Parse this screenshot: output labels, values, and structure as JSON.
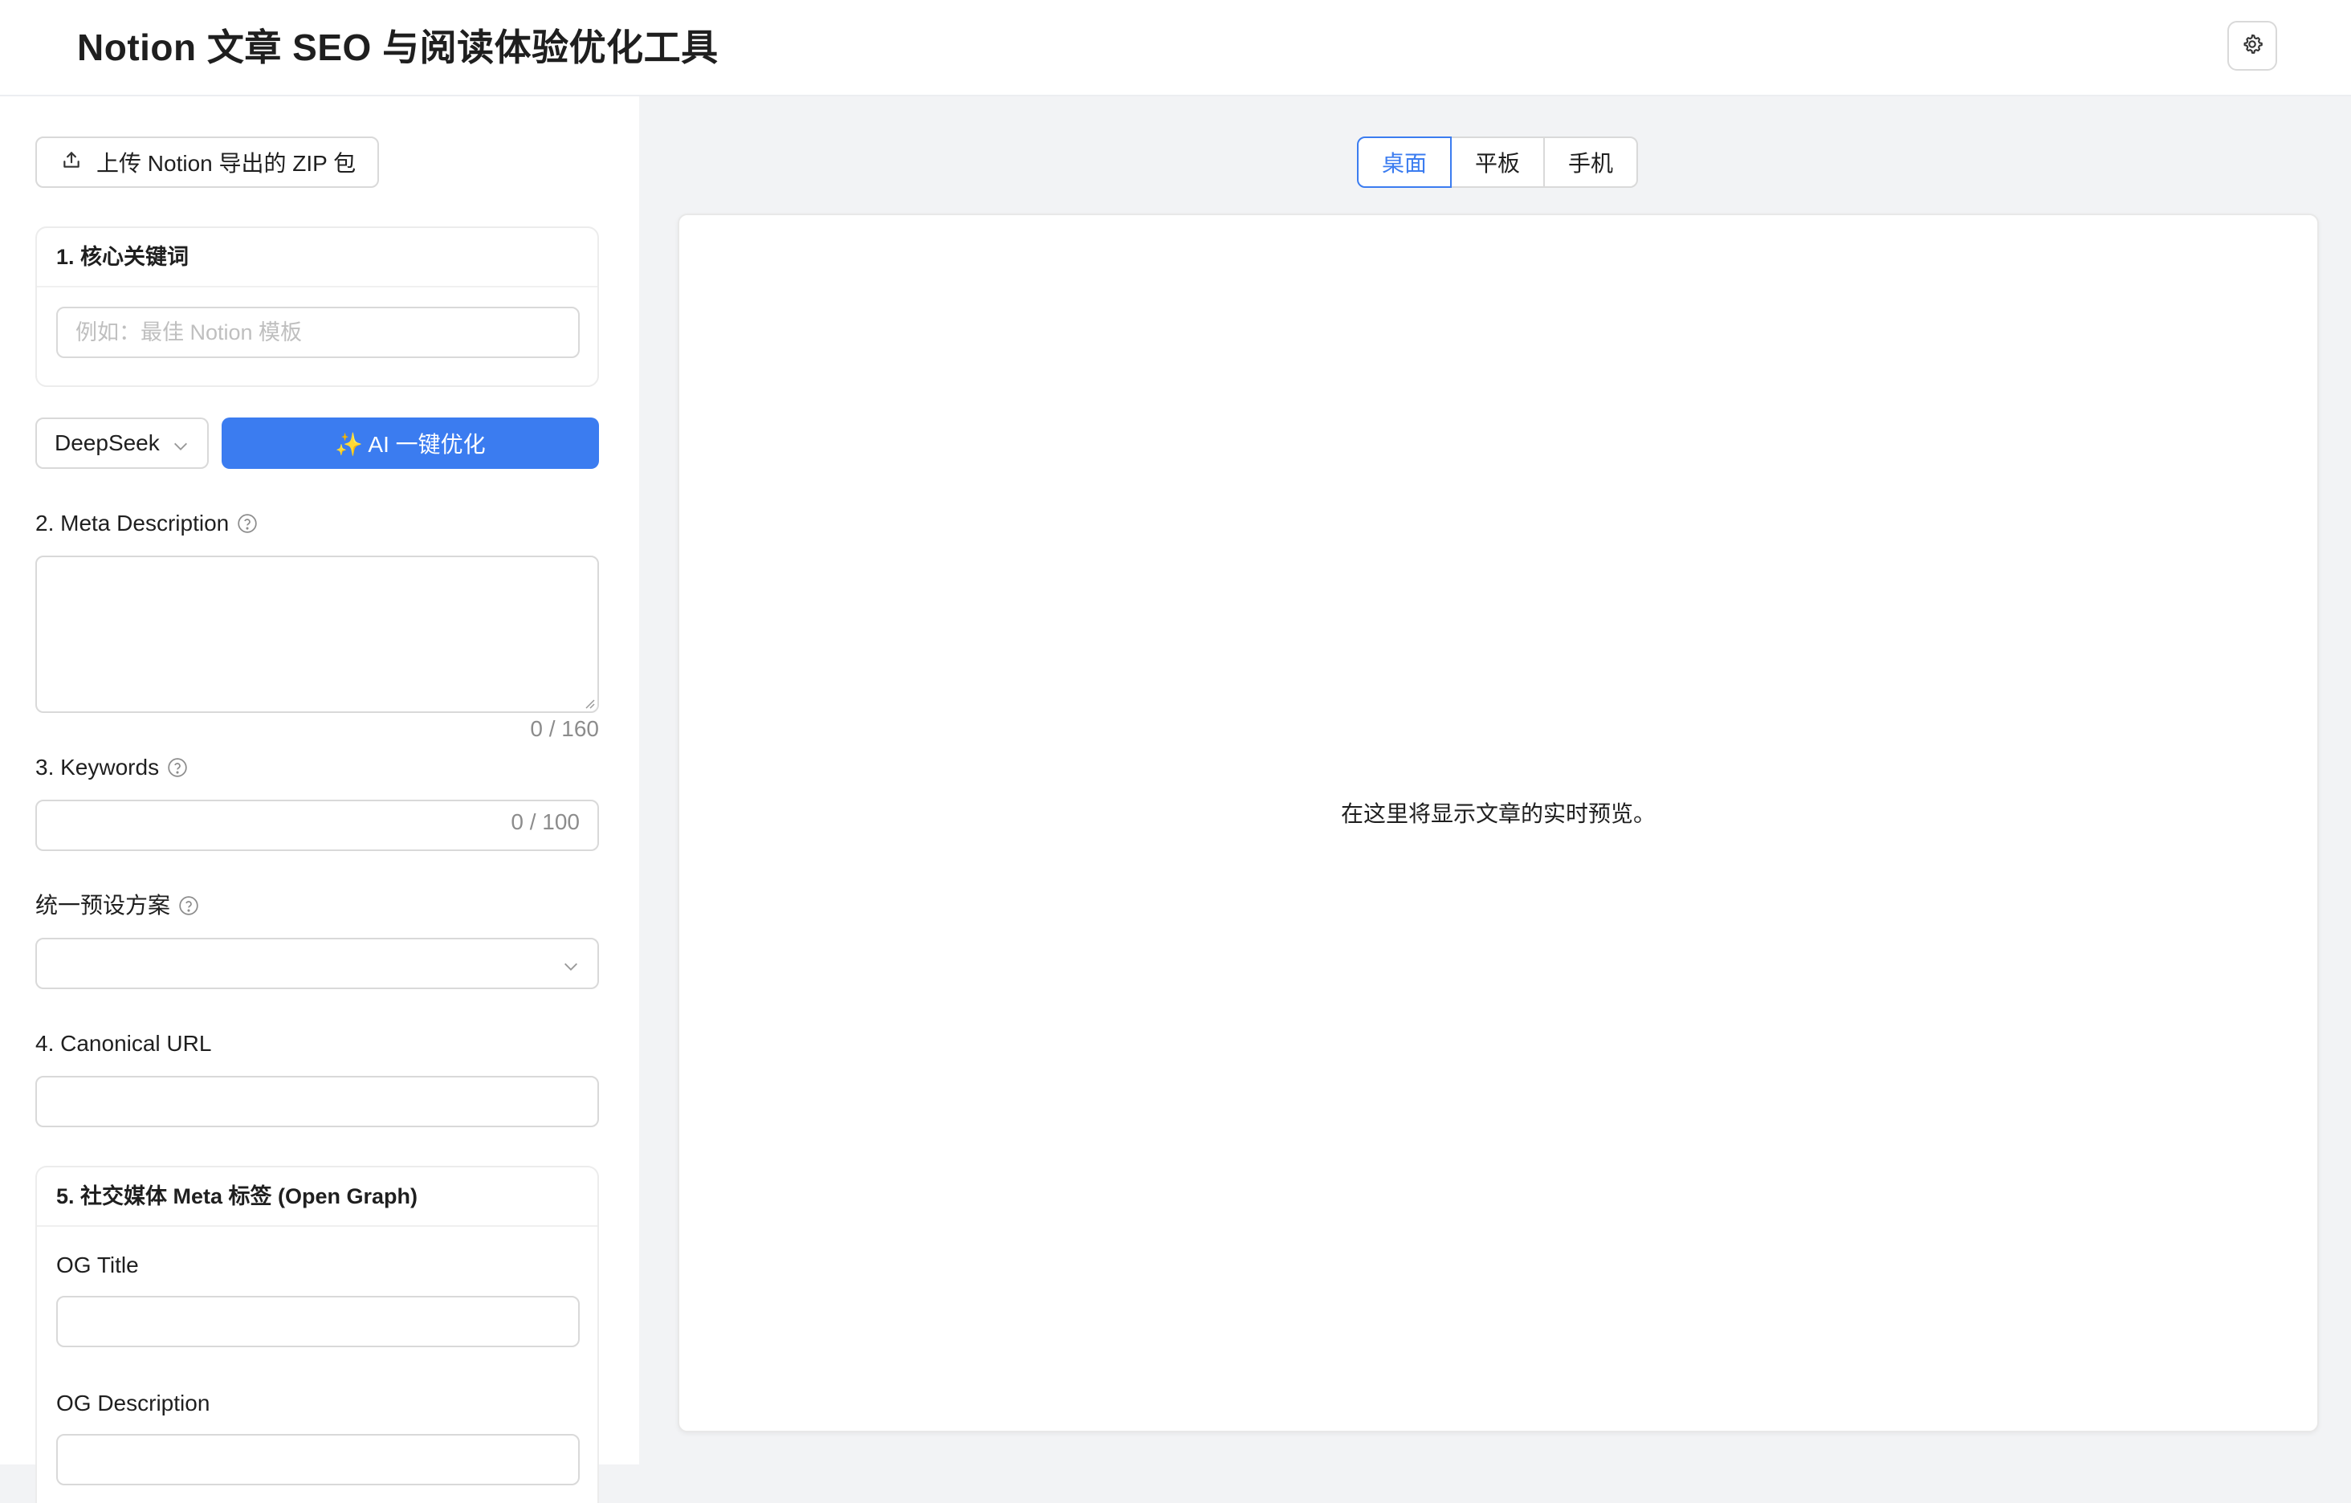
{
  "header": {
    "title": "Notion 文章 SEO 与阅读体验优化工具",
    "settings_icon": "gear-icon"
  },
  "sidebar": {
    "upload_label": "上传 Notion 导出的 ZIP 包",
    "keyword_card": {
      "title": "1. 核心关键词",
      "placeholder": "例如：最佳 Notion 模板",
      "value": ""
    },
    "model_select": {
      "value": "DeepSeek"
    },
    "ai_button": "✨ AI 一键优化",
    "meta_description": {
      "label": "2. Meta Description",
      "value": "",
      "counter": "0 / 160"
    },
    "keywords": {
      "label": "3. Keywords",
      "value": "",
      "counter": "0 / 100"
    },
    "preset": {
      "label": "统一预设方案",
      "value": ""
    },
    "canonical": {
      "label": "4. Canonical URL",
      "value": ""
    },
    "og_card": {
      "title": "5. 社交媒体 Meta 标签 (Open Graph)",
      "og_title_label": "OG Title",
      "og_title_value": "",
      "og_description_label": "OG Description",
      "og_description_value": ""
    }
  },
  "preview": {
    "tabs": [
      {
        "label": "桌面",
        "active": true
      },
      {
        "label": "平板",
        "active": false
      },
      {
        "label": "手机",
        "active": false
      }
    ],
    "placeholder_text": "在这里将显示文章的实时预览。"
  },
  "colors": {
    "accent": "#3b7cf0",
    "background": "#f2f3f5",
    "border": "#d9d9d9"
  }
}
